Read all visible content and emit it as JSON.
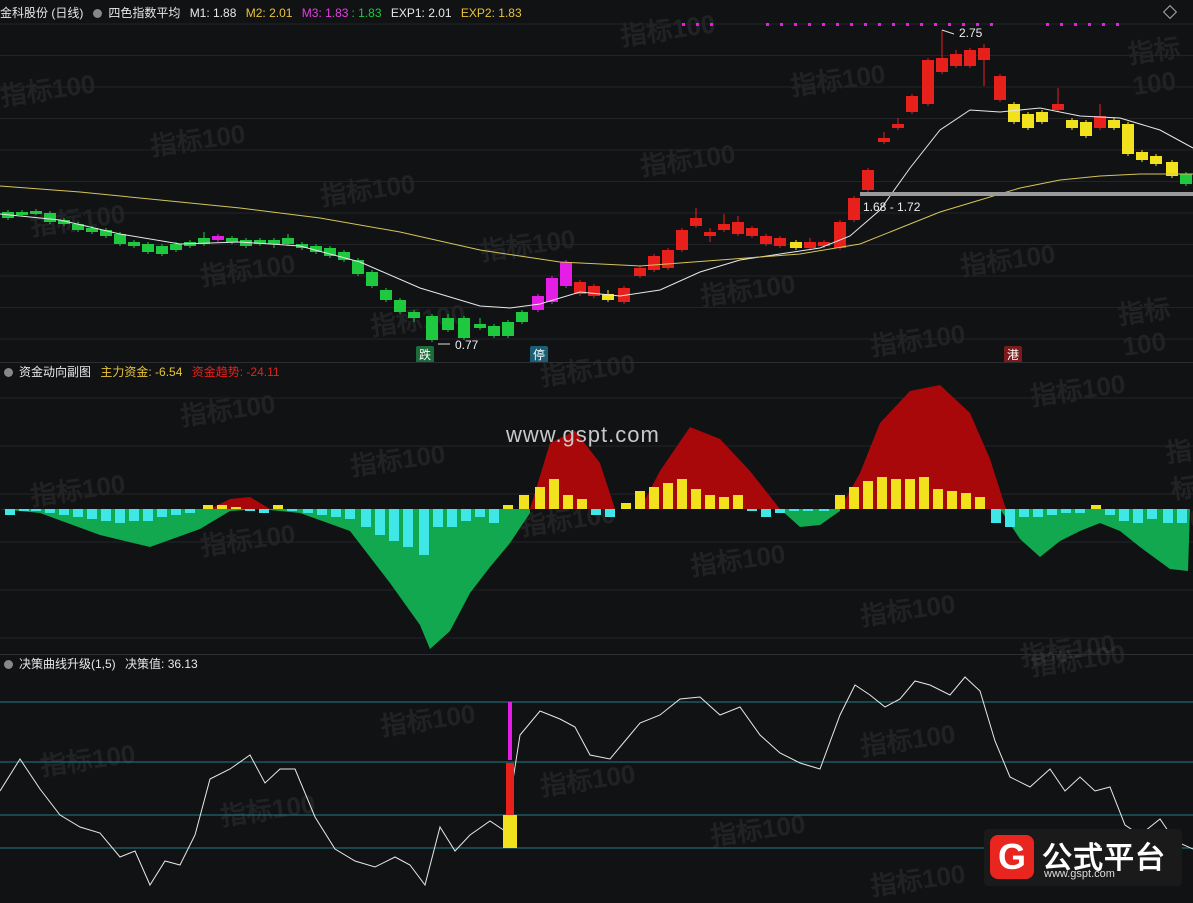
{
  "colors": {
    "bg": "#111214",
    "red": "#e8201c",
    "green": "#1ec93f",
    "yellow": "#f2e21d",
    "magenta": "#e41ee4",
    "cyan": "#3fe7e6",
    "darkred": "#a8080a",
    "darkgreen": "#12a850",
    "white": "#e8e8e8",
    "gold": "#d6c45a"
  },
  "main": {
    "stock_name": "金科股份 (日线)",
    "indicator": "四色指数平均",
    "m1": "M1: 1.88",
    "m2": "M2: 2.01",
    "m3": "M3: 1.83",
    "m3b": ": 1.83",
    "exp1": "EXP1: 2.01",
    "exp2": "EXP2: 1.83",
    "high_label": "2.75",
    "low_label": "0.77",
    "range_label": "1.68 - 1.72",
    "signals": [
      "跌",
      "停",
      "港"
    ]
  },
  "fund": {
    "title": "资金动向副图",
    "main_fund": "主力资金: -6.54",
    "trend": "资金趋势: -24.11",
    "site": "www.gspt.com"
  },
  "decision": {
    "title": "决策曲线升级(1,5)",
    "value": "决策值: 36.13"
  },
  "watermark": "指标100",
  "logo": {
    "glyph": "G",
    "name": "公式平台",
    "url": "www.gspt.com"
  }
}
